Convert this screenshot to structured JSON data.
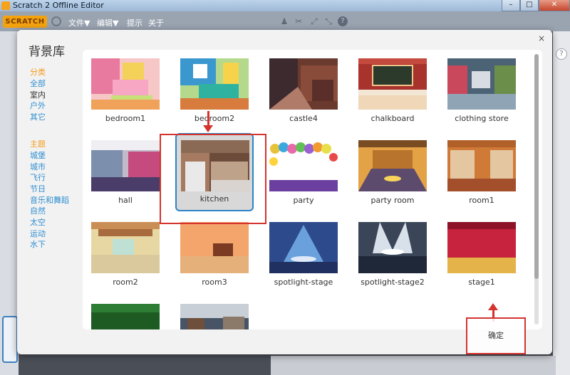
{
  "window": {
    "title": "Scratch 2 Offline Editor"
  },
  "menubar": {
    "logo_text": "SCRATCH",
    "items": [
      "文件▼",
      "编辑▼",
      "提示",
      "关于"
    ]
  },
  "dialog": {
    "title": "背景库",
    "close_label": "×",
    "ok_label": "确定",
    "sidebar": {
      "category_header": "分类",
      "categories": [
        "全部",
        "室内",
        "户外",
        "其它"
      ],
      "theme_header": "主题",
      "themes": [
        "城堡",
        "城市",
        "飞行",
        "节日",
        "音乐和舞蹈",
        "自然",
        "太空",
        "运动",
        "水下"
      ]
    },
    "backdrops": [
      {
        "label": "bedroom1"
      },
      {
        "label": "bedroom2"
      },
      {
        "label": "castle4"
      },
      {
        "label": "chalkboard"
      },
      {
        "label": "clothing store"
      },
      {
        "label": "hall"
      },
      {
        "label": "kitchen",
        "selected": true
      },
      {
        "label": "party"
      },
      {
        "label": "party room"
      },
      {
        "label": "room1"
      },
      {
        "label": "room2"
      },
      {
        "label": "room3"
      },
      {
        "label": "spotlight-stage"
      },
      {
        "label": "spotlight-stage2"
      },
      {
        "label": "stage1"
      },
      {
        "label": ""
      },
      {
        "label": ""
      }
    ]
  },
  "colors": {
    "accent_blue": "#2c84c7",
    "category_orange": "#f59b1a",
    "link_blue": "#2f8fd0",
    "annotation_red": "#d4332e"
  }
}
